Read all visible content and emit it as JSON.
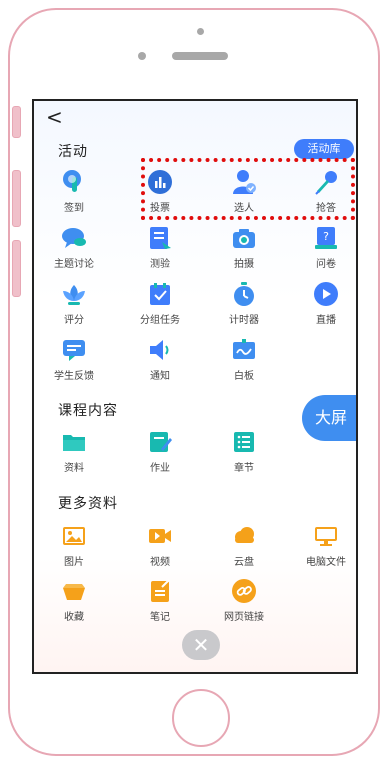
{
  "header": {
    "back_label": "<"
  },
  "sections": {
    "activity": "活动",
    "course": "课程内容",
    "more": "更多资料"
  },
  "activity_library_label": "活动库",
  "big_screen_label": "大屏",
  "close_label": "✕",
  "activities": [
    {
      "label": "签到",
      "icon": "touch-icon"
    },
    {
      "label": "投票",
      "icon": "bar-chart-icon"
    },
    {
      "label": "选人",
      "icon": "person-select-icon"
    },
    {
      "label": "抢答",
      "icon": "microphone-icon"
    },
    {
      "label": "主题讨论",
      "icon": "chat-bubble-icon"
    },
    {
      "label": "测验",
      "icon": "quiz-icon"
    },
    {
      "label": "拍摄",
      "icon": "camera-icon"
    },
    {
      "label": "问卷",
      "icon": "questionnaire-icon"
    },
    {
      "label": "评分",
      "icon": "lotus-icon"
    },
    {
      "label": "分组任务",
      "icon": "group-task-icon"
    },
    {
      "label": "计时器",
      "icon": "timer-icon"
    },
    {
      "label": "直播",
      "icon": "live-play-icon"
    },
    {
      "label": "学生反馈",
      "icon": "feedback-icon"
    },
    {
      "label": "通知",
      "icon": "speaker-icon"
    },
    {
      "label": "白板",
      "icon": "whiteboard-icon"
    }
  ],
  "course": [
    {
      "label": "资料",
      "icon": "folder-icon"
    },
    {
      "label": "作业",
      "icon": "homework-icon"
    },
    {
      "label": "章节",
      "icon": "chapter-list-icon"
    }
  ],
  "more": [
    {
      "label": "图片",
      "icon": "image-icon"
    },
    {
      "label": "视频",
      "icon": "video-icon"
    },
    {
      "label": "云盘",
      "icon": "cloud-icon"
    },
    {
      "label": "电脑文件",
      "icon": "monitor-icon"
    },
    {
      "label": "收藏",
      "icon": "favorites-icon"
    },
    {
      "label": "笔记",
      "icon": "note-icon"
    },
    {
      "label": "网页链接",
      "icon": "link-icon"
    }
  ],
  "colors": {
    "primary": "#3f7dfb",
    "teal": "#18b9b0",
    "orange": "#f5a11a",
    "highlight": "#e00d0d"
  }
}
